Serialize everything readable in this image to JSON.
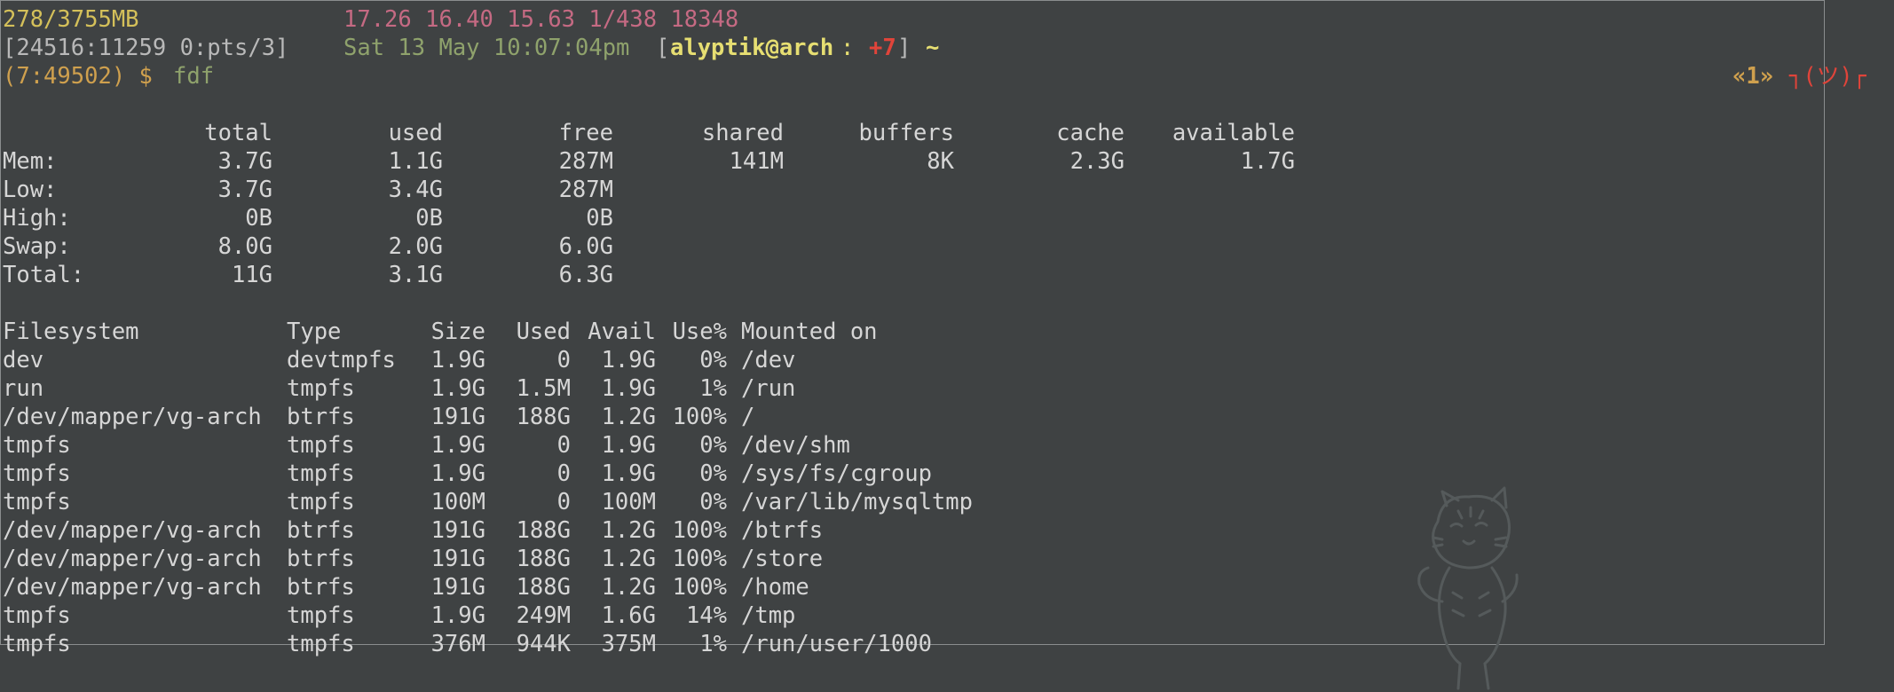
{
  "status": {
    "memory": "278/3755MB",
    "load": "17.26 16.40 15.63 1/438 18348",
    "session": "[24516:11259 0:pts/3]",
    "datetime": "Sat 13 May 10:07:04pm",
    "bracket_open": "[",
    "userhost": "alyptik@arch",
    "colon": ":",
    "jobs": "+7",
    "bracket_close": "]",
    "cwd": "~"
  },
  "prompt": {
    "prefix": "(7:49502) $ ",
    "command": "fdf",
    "window_index": "«1»",
    "shrug": "┐(ツ)┌"
  },
  "free": {
    "headers": [
      "total",
      "used",
      "free",
      "shared",
      "buffers",
      "cache",
      "available"
    ],
    "rows": [
      {
        "label": "Mem:",
        "values": [
          "3.7G",
          "1.1G",
          "287M",
          "141M",
          "8K",
          "2.3G",
          "1.7G"
        ]
      },
      {
        "label": "Low:",
        "values": [
          "3.7G",
          "3.4G",
          "287M",
          "",
          "",
          "",
          ""
        ]
      },
      {
        "label": "High:",
        "values": [
          "0B",
          "0B",
          "0B",
          "",
          "",
          "",
          ""
        ]
      },
      {
        "label": "Swap:",
        "values": [
          "8.0G",
          "2.0G",
          "6.0G",
          "",
          "",
          "",
          ""
        ]
      },
      {
        "label": "Total:",
        "values": [
          "11G",
          "3.1G",
          "6.3G",
          "",
          "",
          "",
          ""
        ]
      }
    ]
  },
  "df": {
    "headers": [
      "Filesystem",
      "Type",
      "Size",
      "Used",
      "Avail",
      "Use%",
      "Mounted on"
    ],
    "rows": [
      [
        "dev",
        "devtmpfs",
        "1.9G",
        "0",
        "1.9G",
        "0%",
        "/dev"
      ],
      [
        "run",
        "tmpfs",
        "1.9G",
        "1.5M",
        "1.9G",
        "1%",
        "/run"
      ],
      [
        "/dev/mapper/vg-arch",
        "btrfs",
        "191G",
        "188G",
        "1.2G",
        "100%",
        "/"
      ],
      [
        "tmpfs",
        "tmpfs",
        "1.9G",
        "0",
        "1.9G",
        "0%",
        "/dev/shm"
      ],
      [
        "tmpfs",
        "tmpfs",
        "1.9G",
        "0",
        "1.9G",
        "0%",
        "/sys/fs/cgroup"
      ],
      [
        "tmpfs",
        "tmpfs",
        "100M",
        "0",
        "100M",
        "0%",
        "/var/lib/mysqltmp"
      ],
      [
        "/dev/mapper/vg-arch",
        "btrfs",
        "191G",
        "188G",
        "1.2G",
        "100%",
        "/btrfs"
      ],
      [
        "/dev/mapper/vg-arch",
        "btrfs",
        "191G",
        "188G",
        "1.2G",
        "100%",
        "/store"
      ],
      [
        "/dev/mapper/vg-arch",
        "btrfs",
        "191G",
        "188G",
        "1.2G",
        "100%",
        "/home"
      ],
      [
        "tmpfs",
        "tmpfs",
        "1.9G",
        "249M",
        "1.6G",
        "14%",
        "/tmp"
      ],
      [
        "tmpfs",
        "tmpfs",
        "376M",
        "944K",
        "375M",
        "1%",
        "/run/user/1000"
      ]
    ]
  },
  "colors": {
    "background": "#3f4243",
    "foreground": "#d6d6d6",
    "status_memory": "#d4c05a",
    "status_load": "#c56a83",
    "datetime": "#8fa26c",
    "userhost": "#e6de72",
    "jobs": "#e0443a",
    "prompt": "#cfa04e"
  },
  "icons": {
    "mascot": "tiger-cub-doodle-icon"
  }
}
